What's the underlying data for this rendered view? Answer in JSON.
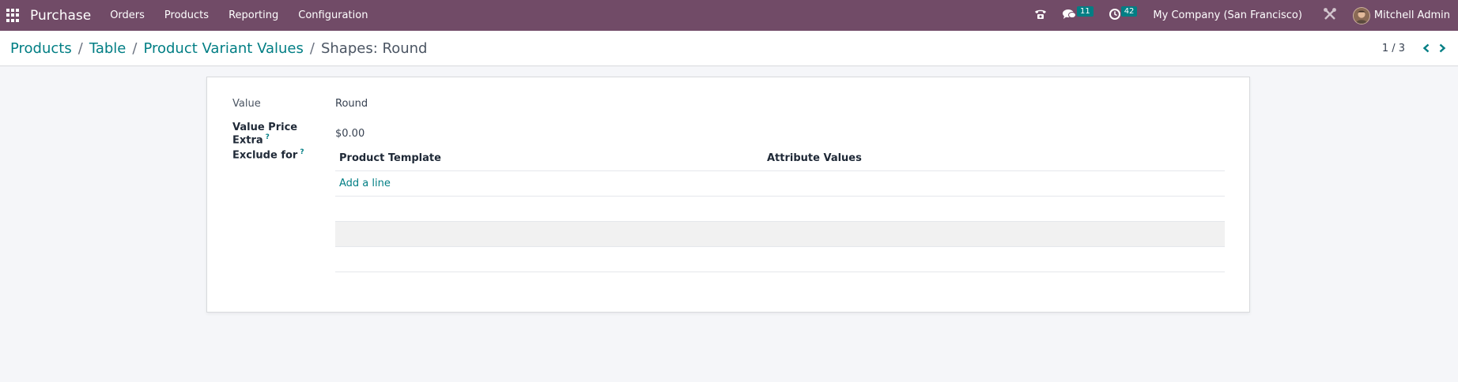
{
  "navbar": {
    "app_name": "Purchase",
    "menu": [
      "Orders",
      "Products",
      "Reporting",
      "Configuration"
    ],
    "messages_count": "11",
    "activities_count": "42",
    "company": "My Company (San Francisco)",
    "user": "Mitchell Admin",
    "bg_color": "#714b67"
  },
  "breadcrumb": {
    "items": [
      "Products",
      "Table",
      "Product Variant Values"
    ],
    "current": "Shapes: Round"
  },
  "pager": {
    "value": "1 / 3"
  },
  "form": {
    "value_label": "Value",
    "value": "Round",
    "price_extra_label": "Value Price Extra",
    "price_extra_help": "?",
    "price_extra": "$0.00",
    "exclude_label": "Exclude for",
    "exclude_help": "?",
    "table": {
      "columns": [
        "Product Template",
        "Attribute Values"
      ],
      "add_line": "Add a line"
    }
  },
  "accent_color": "#017e84"
}
